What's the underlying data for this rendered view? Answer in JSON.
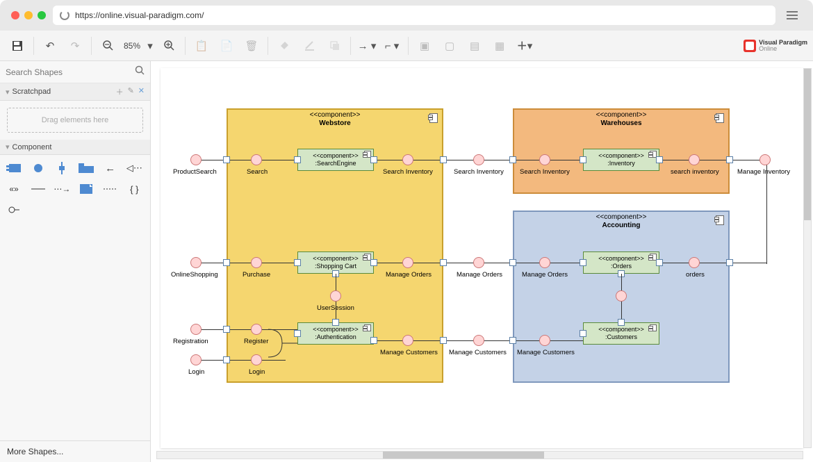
{
  "url": "https://online.visual-paradigm.com/",
  "brand": {
    "line1": "Visual Paradigm",
    "line2": "Online"
  },
  "toolbar": {
    "zoom": "85%"
  },
  "sidebar": {
    "search_placeholder": "Search Shapes",
    "scratchpad": "Scratchpad",
    "dropzone": "Drag elements here",
    "component": "Component",
    "more": "More Shapes..."
  },
  "diagram": {
    "containers": {
      "webstore": {
        "stereo": "<<component>>",
        "name": "Webstore"
      },
      "warehouses": {
        "stereo": "<<component>>",
        "name": "Warehouses"
      },
      "accounting": {
        "stereo": "<<component>>",
        "name": "Accounting"
      }
    },
    "components": {
      "search_engine": {
        "stereo": "<<component>>",
        "name": ":SearchEngine"
      },
      "inventory": {
        "stereo": "<<component>>",
        "name": ":Inventory"
      },
      "shopping_cart": {
        "stereo": "<<component>>",
        "name": ":Shopping Cart"
      },
      "authentication": {
        "stereo": "<<component>>",
        "name": ":Authentication"
      },
      "orders": {
        "stereo": "<<component>>",
        "name": ":Orders"
      },
      "customers": {
        "stereo": "<<component>>",
        "name": ":Customers"
      }
    },
    "interfaces": {
      "product_search": "ProductSearch",
      "search": "Search",
      "search_inventory_ws": "Search Inventory",
      "search_inventory_edge": "Search Inventory",
      "search_inventory_wh": "Search Inventory",
      "search_inventory_inv": "search inventory",
      "manage_inventory": "Manage Inventory",
      "online_shopping": "OnlineShopping",
      "purchase": "Purchase",
      "manage_orders_ws": "Manage Orders",
      "manage_orders_edge": "Manage Orders",
      "manage_orders_acc": "Manage Orders",
      "orders_r": "orders",
      "user_session": "UserSession",
      "registration": "Registration",
      "register": "Register",
      "login": "Login",
      "login_r": "Login",
      "manage_customers_ws": "Manage Customers",
      "manage_customers_edge": "Manage Customers",
      "manage_customers_acc": "Manage Customers"
    }
  }
}
